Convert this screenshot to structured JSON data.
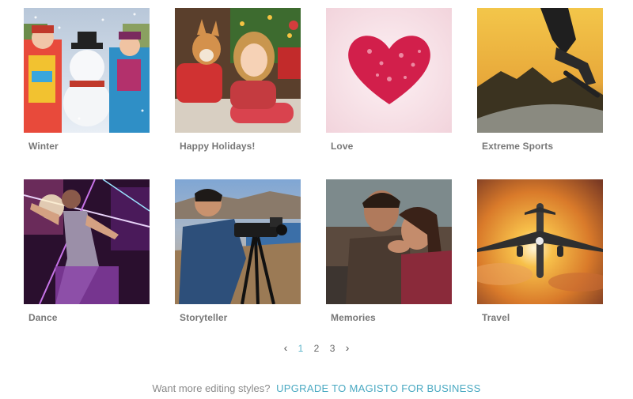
{
  "styles": [
    {
      "label": "Winter",
      "icon": "winter-thumbnail"
    },
    {
      "label": "Happy Holidays!",
      "icon": "holidays-thumbnail"
    },
    {
      "label": "Love",
      "icon": "love-heart-thumbnail"
    },
    {
      "label": "Extreme Sports",
      "icon": "skater-thumbnail"
    },
    {
      "label": "Dance",
      "icon": "dance-thumbnail"
    },
    {
      "label": "Storyteller",
      "icon": "camera-operator-thumbnail"
    },
    {
      "label": "Memories",
      "icon": "couple-thumbnail"
    },
    {
      "label": "Travel",
      "icon": "airplane-thumbnail"
    }
  ],
  "pagination": {
    "prev": "‹",
    "pages": [
      "1",
      "2",
      "3"
    ],
    "current": "1",
    "next": "›"
  },
  "footer": {
    "prompt": "Want more editing styles?",
    "link": "UPGRADE TO MAGISTO FOR BUSINESS"
  },
  "colors": {
    "accent": "#4aa9c2",
    "label_text": "#777777"
  }
}
